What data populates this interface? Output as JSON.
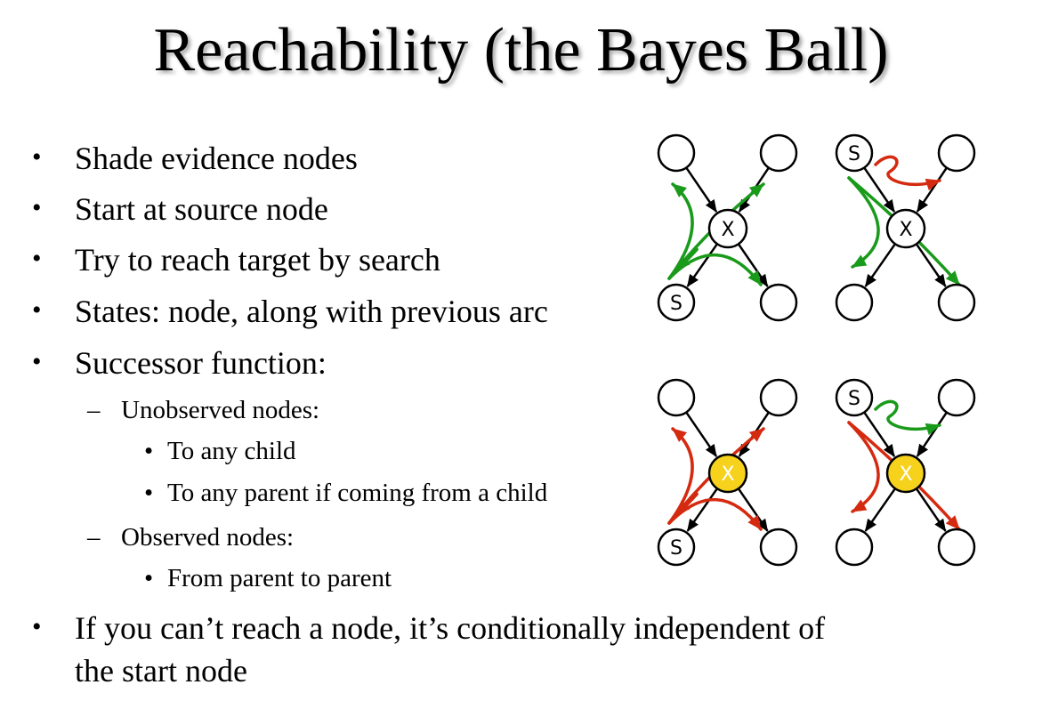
{
  "title": "Reachability (the Bayes Ball)",
  "bullets": [
    {
      "level": 1,
      "marker": "•",
      "text": "Shade evidence nodes"
    },
    {
      "level": 1,
      "marker": "•",
      "text": "Start at source node"
    },
    {
      "level": 1,
      "marker": "•",
      "text": "Try to reach target by search"
    },
    {
      "level": 1,
      "marker": "•",
      "text": "States: node, along with previous arc"
    },
    {
      "level": 1,
      "marker": "•",
      "text": "Successor function:"
    },
    {
      "level": 2,
      "marker": "–",
      "text": "Unobserved nodes:"
    },
    {
      "level": 3,
      "marker": "•",
      "text": "To any child"
    },
    {
      "level": 3,
      "marker": "•",
      "text": "To any parent if coming from a child"
    },
    {
      "level": 2,
      "marker": "–",
      "text": "Observed nodes:"
    },
    {
      "level": 3,
      "marker": "•",
      "text": "From parent to parent"
    },
    {
      "level": 1,
      "marker": "•",
      "text": "If you can’t reach a node, it’s conditionally independent of"
    },
    {
      "level": 1,
      "marker": "",
      "text": "the start node"
    }
  ],
  "diagrams": [
    {
      "center_label": "X",
      "source_label": "S",
      "observed": false,
      "source_position": "bottom-left",
      "path_color": "#1a9a1a"
    },
    {
      "center_label": "X",
      "source_label": "S",
      "observed": false,
      "source_position": "top-left",
      "path_color": "#1a9a1a",
      "loop_color": "#d42a10"
    },
    {
      "center_label": "X",
      "source_label": "S",
      "observed": true,
      "source_position": "bottom-left",
      "path_color": "#d42a10"
    },
    {
      "center_label": "X",
      "source_label": "S",
      "observed": true,
      "source_position": "top-left",
      "path_color": "#d42a10",
      "loop_color": "#1a9a1a"
    }
  ],
  "colors": {
    "green": "#1a9a1a",
    "red": "#d42a10",
    "observed_fill": "#f6d21c",
    "node_fill": "#ffffff",
    "arc": "#000000"
  }
}
